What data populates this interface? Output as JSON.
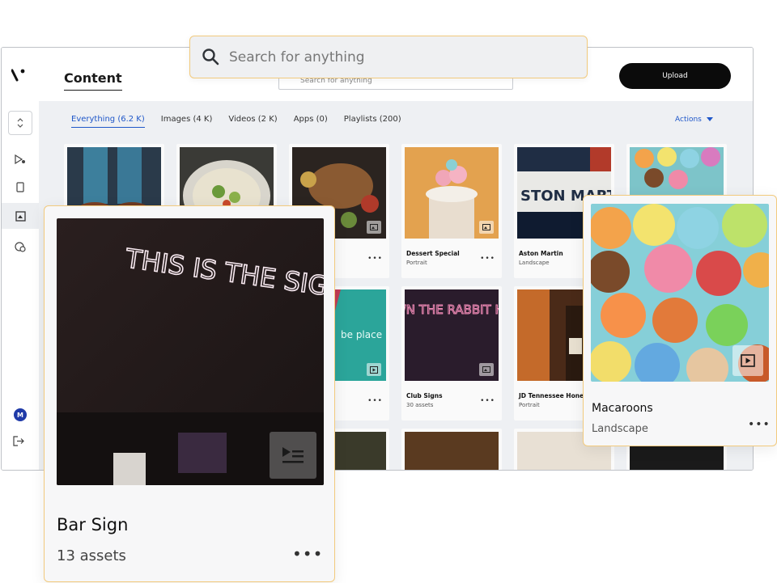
{
  "app": {
    "logo_text": "\\'",
    "page_title": "Content",
    "search_placeholder_small": "Search for anything",
    "upload_label": "Upload",
    "avatar_initial": "M"
  },
  "search": {
    "placeholder": "Search for anything"
  },
  "tabs": [
    {
      "label": "Everything (6.2 K)",
      "active": true
    },
    {
      "label": "Images (4 K)"
    },
    {
      "label": "Videos (2 K)"
    },
    {
      "label": "Apps (0)"
    },
    {
      "label": "Playlists (200)"
    }
  ],
  "actions_label": "Actions",
  "grid": {
    "row1": [
      {
        "title": "",
        "sub": ""
      },
      {
        "title": "",
        "sub": ""
      },
      {
        "title": "",
        "sub": ""
      },
      {
        "title": "Dessert Special",
        "sub": "Portrait"
      },
      {
        "title": "Aston Martin",
        "sub": "Landscape"
      },
      {
        "title": "",
        "sub": ""
      }
    ],
    "row2": [
      {
        "title": "",
        "sub": ""
      },
      {
        "title": "",
        "sub": ""
      },
      {
        "title": "",
        "sub": ""
      },
      {
        "title": "Club Signs",
        "sub": "30 assets"
      },
      {
        "title": "JD Tennessee Honey",
        "sub": "Portrait"
      },
      {
        "title": "",
        "sub": ""
      }
    ]
  },
  "image_text": {
    "club_sign": "DOWN THE RABBIT HOLE",
    "teal_sign": "be place",
    "car_text": "STON MART",
    "bar_sign_neon": "THIS IS THE SIGN YOU'VE BEEN LOOKING FOR"
  },
  "float_bar": {
    "title": "Bar Sign",
    "sub": "13 assets"
  },
  "float_mac": {
    "title": "Macaroons",
    "sub": "Landscape"
  },
  "more_glyph": "•••",
  "colors": {
    "accent": "#1f57c9",
    "highlight_border": "#f2ca7d",
    "upload_bg": "#0b0b0b",
    "avatar_bg": "#1f3aa8"
  },
  "icons": [
    "search-icon",
    "chevron-updown-icon",
    "media-icon",
    "device-icon",
    "content-icon",
    "schedule-icon",
    "logout-icon",
    "image-type-icon",
    "video-type-icon",
    "playlist-type-icon",
    "caret-down-icon"
  ]
}
